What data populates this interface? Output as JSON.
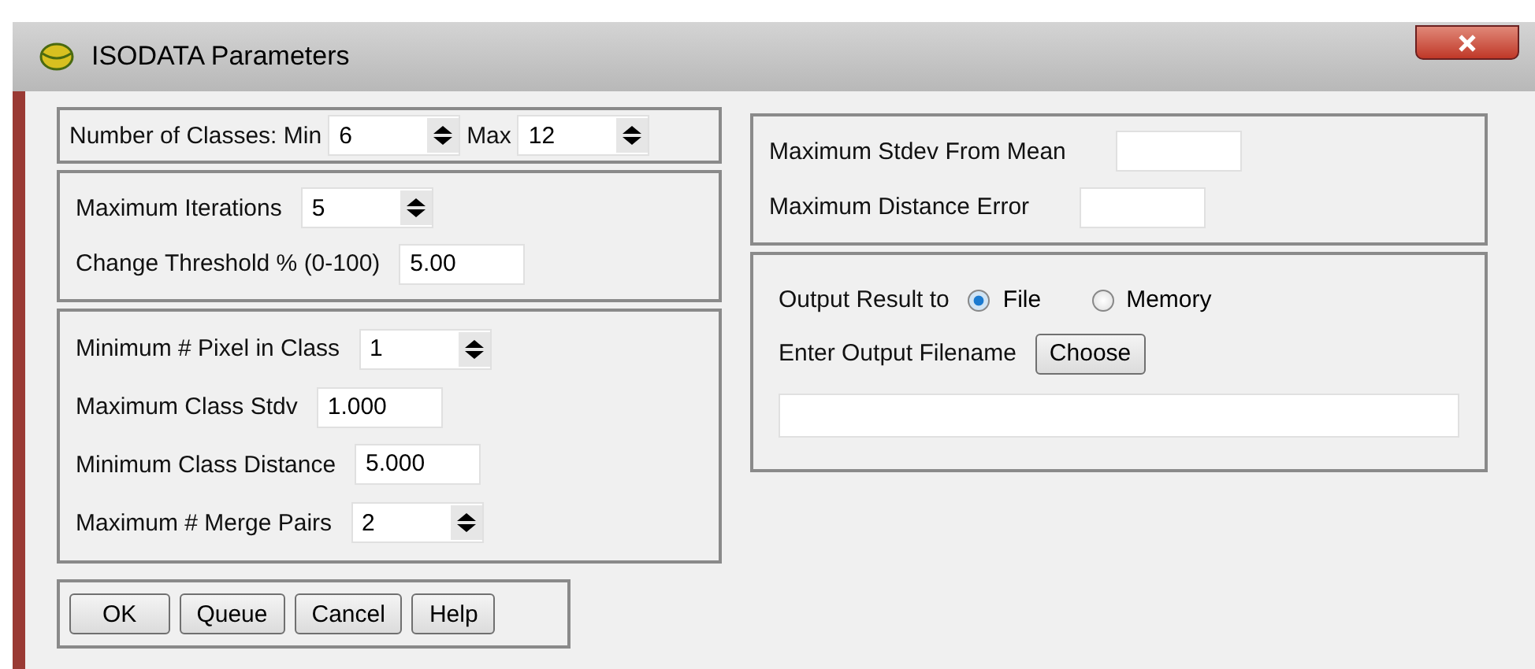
{
  "window": {
    "title": "ISODATA Parameters"
  },
  "left_groups": [
    {
      "rows": [
        {
          "items": [
            {
              "kind": "label",
              "text": "Number of Classes: Min"
            },
            {
              "kind": "spinner",
              "value": "6"
            },
            {
              "kind": "label",
              "text": "Max"
            },
            {
              "kind": "spinner",
              "value": "12"
            }
          ]
        }
      ]
    },
    {
      "rows": [
        {
          "items": [
            {
              "kind": "label",
              "text": "Maximum Iterations"
            },
            {
              "kind": "spinner",
              "value": "5"
            }
          ]
        },
        {
          "items": [
            {
              "kind": "label",
              "text": "Change Threshold % (0-100)"
            },
            {
              "kind": "field",
              "value": "5.00"
            }
          ]
        }
      ]
    },
    {
      "rows": [
        {
          "items": [
            {
              "kind": "label",
              "text": "Minimum # Pixel in Class"
            },
            {
              "kind": "spinner",
              "value": "1"
            }
          ]
        },
        {
          "items": [
            {
              "kind": "label",
              "text": "Maximum Class Stdv"
            },
            {
              "kind": "field",
              "value": "1.000"
            }
          ]
        },
        {
          "items": [
            {
              "kind": "label",
              "text": "Minimum Class Distance"
            },
            {
              "kind": "field",
              "value": "5.000"
            }
          ]
        },
        {
          "items": [
            {
              "kind": "label",
              "text": "Maximum # Merge Pairs"
            },
            {
              "kind": "spinner",
              "value": "2"
            }
          ]
        }
      ]
    }
  ],
  "right_groups": [
    {
      "rows": [
        {
          "items": [
            {
              "kind": "label",
              "text": "Maximum Stdev From Mean"
            },
            {
              "kind": "field"
            }
          ]
        },
        {
          "items": [
            {
              "kind": "label",
              "text": "Maximum Distance Error"
            },
            {
              "kind": "field"
            }
          ]
        }
      ]
    },
    {
      "rows": [
        {
          "items": [
            {
              "kind": "label",
              "text": "Output Result to"
            },
            {
              "kind": "radio",
              "text": "File",
              "selected": true
            },
            {
              "kind": "radio",
              "text": "Memory",
              "selected": false
            }
          ]
        },
        {
          "items": [
            {
              "kind": "label",
              "text": "Enter Output Filename"
            },
            {
              "kind": "button",
              "text": "Choose"
            }
          ]
        },
        {
          "items": [
            {
              "kind": "wide-field"
            }
          ]
        }
      ]
    }
  ],
  "buttons": [
    "OK",
    "Queue",
    "Cancel",
    "Help"
  ]
}
